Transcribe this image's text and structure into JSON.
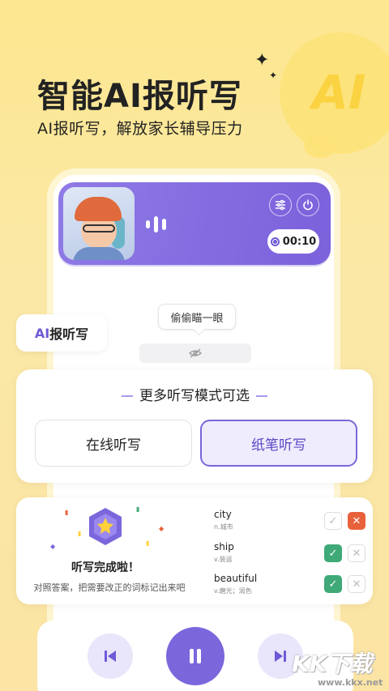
{
  "header": {
    "title": "智能AI报听写",
    "subtitle": "AI报听写，解放家长辅导压力",
    "deco_text": "AI"
  },
  "player": {
    "timer": "00:10",
    "settings_icon": "sliders-icon",
    "power_icon": "power-icon"
  },
  "peek": {
    "label": "偷偷瞄一眼",
    "eye_icon": "eye-off-icon"
  },
  "tag": {
    "prefix": "AI",
    "label": "报听写"
  },
  "modes": {
    "title": "更多听写模式可选",
    "options": [
      {
        "label": "在线听写",
        "selected": false
      },
      {
        "label": "纸笔听写",
        "selected": true
      }
    ]
  },
  "result": {
    "title": "听写完成啦！",
    "subtitle": "对照答案，把需要改正的词标记出来吧",
    "words": [
      {
        "word": "city",
        "meaning": "n.城市",
        "mark": "wrong"
      },
      {
        "word": "ship",
        "meaning": "v.装运",
        "mark": "right"
      },
      {
        "word": "beautiful",
        "meaning": "v.磨光；润色",
        "mark": "right"
      }
    ]
  },
  "watermark": {
    "text": "KK下载",
    "url": "www.kkx.net"
  },
  "colors": {
    "accent": "#7b66dc",
    "background": "#fde991",
    "correct": "#3fa978",
    "wrong": "#e8613a"
  }
}
